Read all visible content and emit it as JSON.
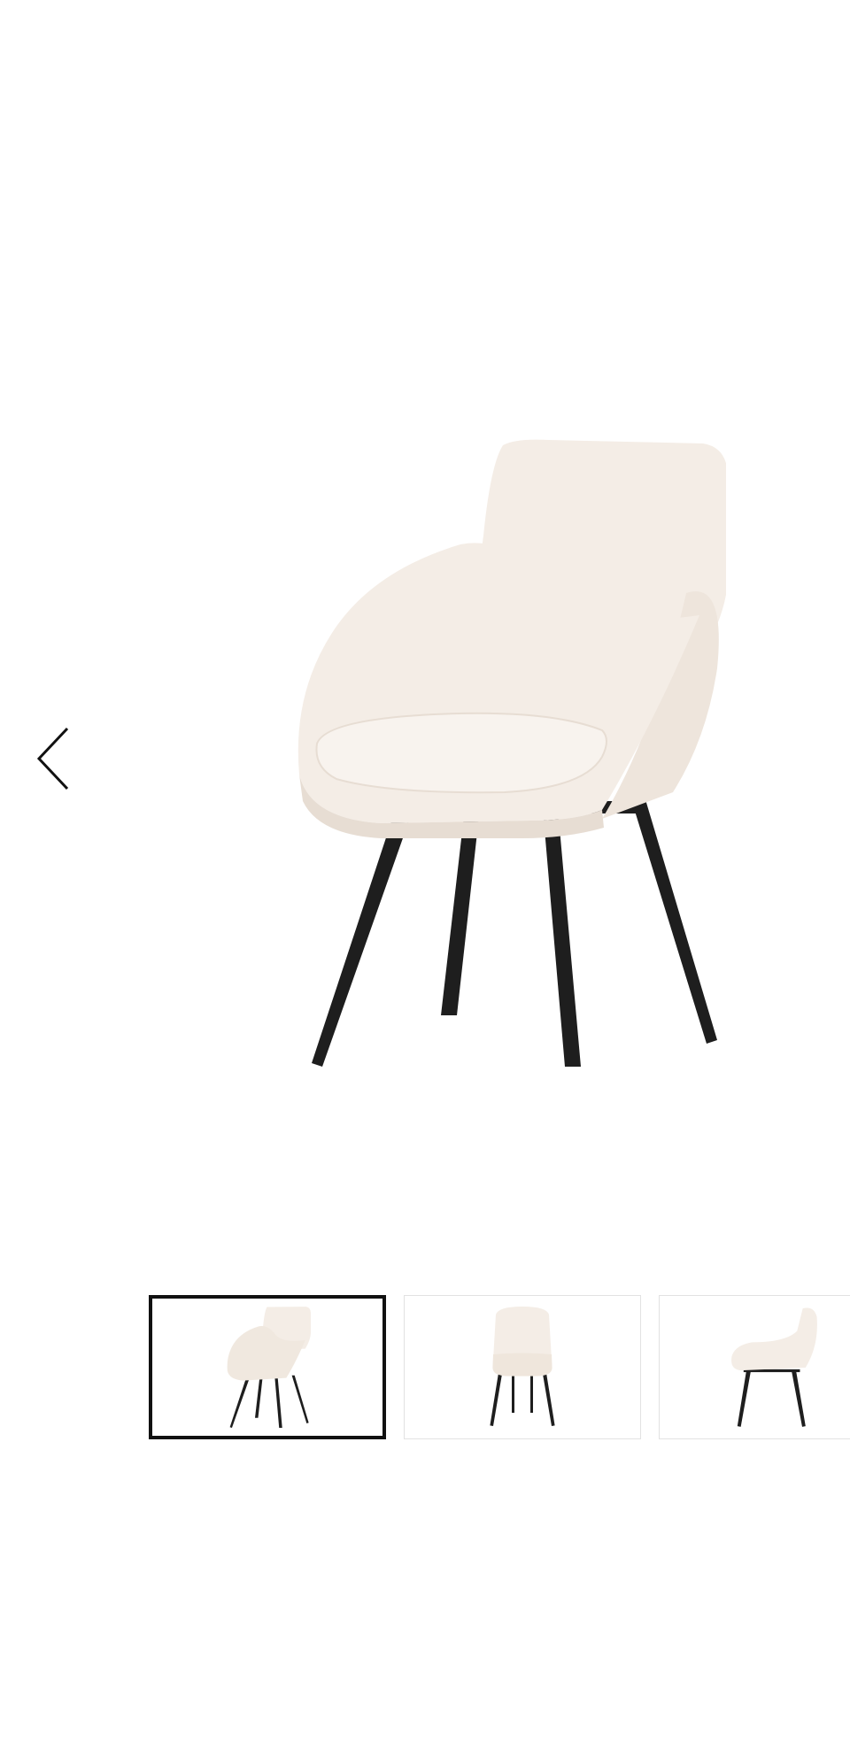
{
  "gallery": {
    "prev_icon": "chevron-left-icon",
    "main_image": "beige-swivel-dining-chair",
    "thumbnails": [
      {
        "view": "three-quarter",
        "selected": true
      },
      {
        "view": "front",
        "selected": false
      },
      {
        "view": "side",
        "selected": false
      }
    ]
  },
  "colors": {
    "fabric": "#f4ede6",
    "fabric_shadow": "#e7ddd3",
    "legs": "#1e1e1e",
    "active_border": "#111111",
    "thumb_border": "#e2e2e2"
  }
}
